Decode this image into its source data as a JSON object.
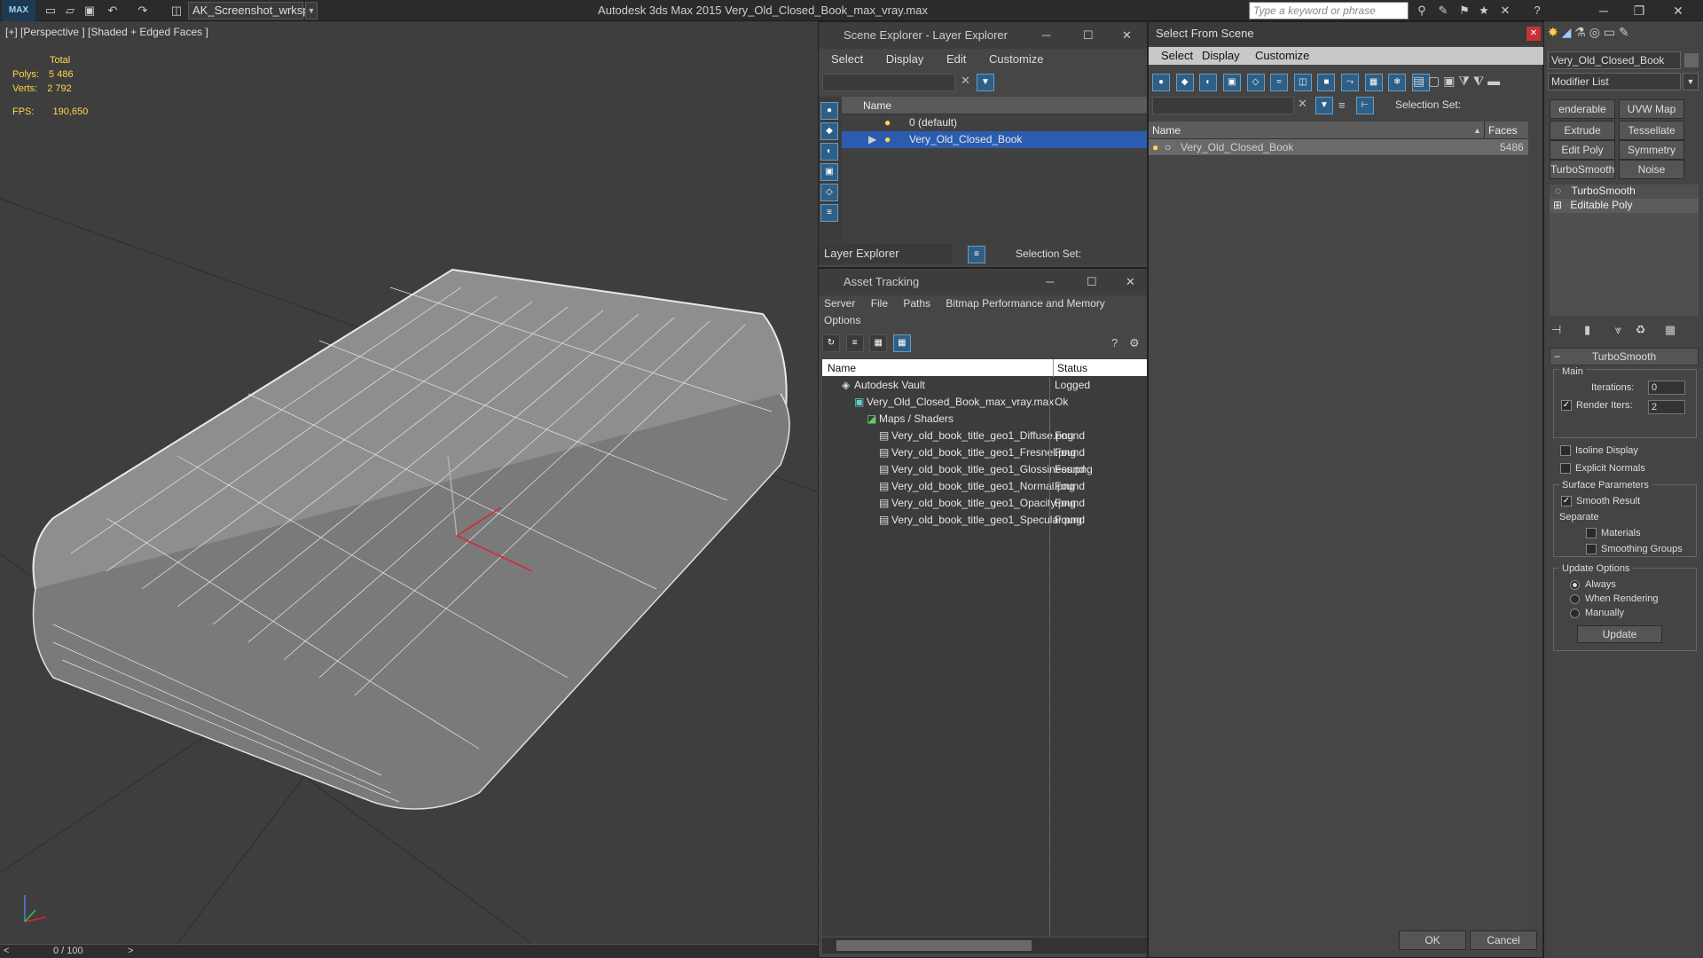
{
  "app": {
    "logo": "MAX",
    "workspace": "AK_Screenshot_wrksp",
    "title": "Autodesk 3ds Max  2015     Very_Old_Closed_Book_max_vray.max",
    "search_placeholder": "Type a keyword or phrase"
  },
  "viewport": {
    "label": "[+] [Perspective ] [Shaded + Edged Faces ]",
    "stats_header": "Total",
    "polys_label": "Polys:",
    "polys_value": "5 486",
    "verts_label": "Verts:",
    "verts_value": "2 792",
    "fps_label": "FPS:",
    "fps_value": "190,650",
    "timeline": "0 / 100"
  },
  "scene_explorer": {
    "title": "Scene Explorer - Layer Explorer",
    "menu": [
      "Select",
      "Display",
      "Edit",
      "Customize"
    ],
    "column": "Name",
    "rows": [
      "0 (default)",
      "Very_Old_Closed_Book"
    ],
    "footer_dropdown": "Layer Explorer",
    "selection_set": "Selection Set:"
  },
  "asset_tracking": {
    "title": "Asset Tracking",
    "menu": [
      "Server",
      "File",
      "Paths",
      "Bitmap Performance and Memory"
    ],
    "menu2": "Options",
    "col_name": "Name",
    "col_status": "Status",
    "rows": [
      {
        "name": "Autodesk Vault",
        "status": "Logged"
      },
      {
        "name": "Very_Old_Closed_Book_max_vray.max",
        "status": "Ok"
      },
      {
        "name": "Maps / Shaders",
        "status": ""
      },
      {
        "name": "Very_old_book_title_geo1_Diffuse.png",
        "status": "Found"
      },
      {
        "name": "Very_old_book_title_geo1_Fresnel.png",
        "status": "Found"
      },
      {
        "name": "Very_old_book_title_geo1_Glossiness.png",
        "status": "Found"
      },
      {
        "name": "Very_old_book_title_geo1_Normal.png",
        "status": "Found"
      },
      {
        "name": "Very_old_book_title_geo1_Opacity.png",
        "status": "Found"
      },
      {
        "name": "Very_old_book_title_geo1_Specular.png",
        "status": "Found"
      }
    ]
  },
  "select_from_scene": {
    "title": "Select From Scene",
    "menu": [
      "Select",
      "Display",
      "Customize"
    ],
    "selection_set": "Selection Set:",
    "col_name": "Name",
    "col_faces": "Faces",
    "row_name": "Very_Old_Closed_Book",
    "row_faces": "5486",
    "ok": "OK",
    "cancel": "Cancel"
  },
  "modify_panel": {
    "object_name": "Very_Old_Closed_Book",
    "modifier_list": "Modifier List",
    "buttons": [
      "enderable Spli",
      "UVW Map",
      "Extrude",
      "Tessellate",
      "Edit Poly",
      "Symmetry",
      "TurboSmooth",
      "Noise"
    ],
    "stack": [
      "TurboSmooth",
      "Editable Poly"
    ],
    "rollout_title": "TurboSmooth",
    "main": "Main",
    "iterations_label": "Iterations:",
    "iterations": "0",
    "render_iters_label": "Render Iters:",
    "render_iters": "2",
    "isoline": "Isoline Display",
    "explicit_normals": "Explicit Normals",
    "surface_params": "Surface Parameters",
    "smooth_result": "Smooth Result",
    "separate": "Separate",
    "materials": "Materials",
    "smoothing_groups": "Smoothing Groups",
    "update_options": "Update Options",
    "always": "Always",
    "when_rendering": "When Rendering",
    "manually": "Manually",
    "update": "Update"
  }
}
